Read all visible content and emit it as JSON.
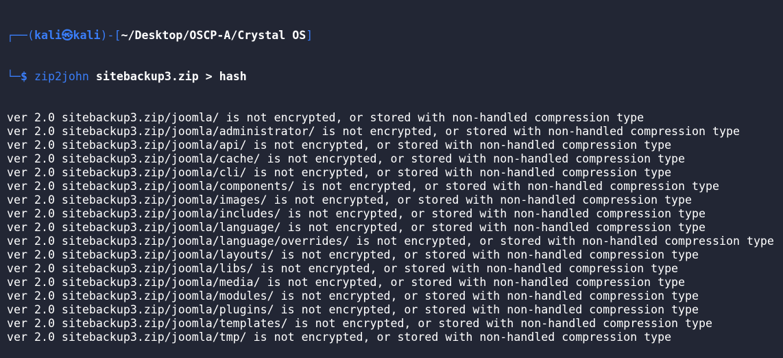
{
  "prompt": {
    "frame_open": "┌──(",
    "user": "kali㉿kali",
    "frame_mid": ")-[",
    "path": "~/Desktop/OSCP-A/Crystal OS",
    "frame_close": "]",
    "frame_bottom": "└─",
    "dollar": "$",
    "command": "zip2john",
    "args": "sitebackup3.zip > hash"
  },
  "output_lines": [
    "ver 2.0 sitebackup3.zip/joomla/ is not encrypted, or stored with non-handled compression type",
    "ver 2.0 sitebackup3.zip/joomla/administrator/ is not encrypted, or stored with non-handled compression type",
    "ver 2.0 sitebackup3.zip/joomla/api/ is not encrypted, or stored with non-handled compression type",
    "ver 2.0 sitebackup3.zip/joomla/cache/ is not encrypted, or stored with non-handled compression type",
    "ver 2.0 sitebackup3.zip/joomla/cli/ is not encrypted, or stored with non-handled compression type",
    "ver 2.0 sitebackup3.zip/joomla/components/ is not encrypted, or stored with non-handled compression type",
    "ver 2.0 sitebackup3.zip/joomla/images/ is not encrypted, or stored with non-handled compression type",
    "ver 2.0 sitebackup3.zip/joomla/includes/ is not encrypted, or stored with non-handled compression type",
    "ver 2.0 sitebackup3.zip/joomla/language/ is not encrypted, or stored with non-handled compression type",
    "ver 2.0 sitebackup3.zip/joomla/language/overrides/ is not encrypted, or stored with non-handled compression type",
    "ver 2.0 sitebackup3.zip/joomla/layouts/ is not encrypted, or stored with non-handled compression type",
    "ver 2.0 sitebackup3.zip/joomla/libs/ is not encrypted, or stored with non-handled compression type",
    "ver 2.0 sitebackup3.zip/joomla/media/ is not encrypted, or stored with non-handled compression type",
    "ver 2.0 sitebackup3.zip/joomla/modules/ is not encrypted, or stored with non-handled compression type",
    "ver 2.0 sitebackup3.zip/joomla/plugins/ is not encrypted, or stored with non-handled compression type",
    "ver 2.0 sitebackup3.zip/joomla/templates/ is not encrypted, or stored with non-handled compression type",
    "ver 2.0 sitebackup3.zip/joomla/tmp/ is not encrypted, or stored with non-handled compression type"
  ],
  "colors": {
    "background": "#222634",
    "prompt_accent": "#3a7df8",
    "text": "#ffffff"
  }
}
